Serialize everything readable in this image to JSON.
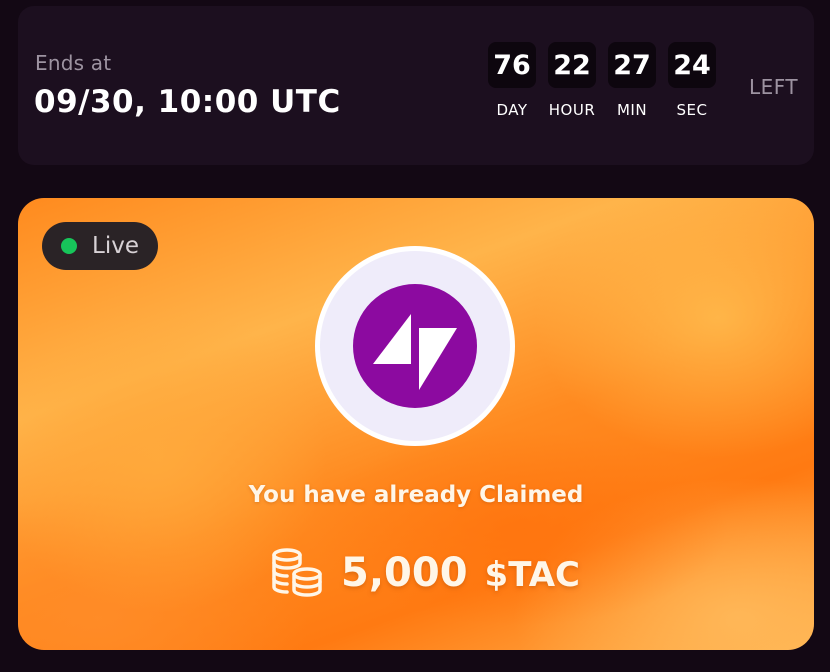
{
  "timer": {
    "ends_label": "Ends at",
    "ends_value": "09/30, 10:00 UTC",
    "units": [
      {
        "value": "76",
        "label": "DAY"
      },
      {
        "value": "22",
        "label": "HOUR"
      },
      {
        "value": "27",
        "label": "MIN"
      },
      {
        "value": "24",
        "label": "SEC"
      }
    ],
    "left_label": "LEFT"
  },
  "claim": {
    "status_label": "Live",
    "status_color": "#17c55a",
    "logo_icon": "tac-logo-icon",
    "logo_color": "#8c0aa0",
    "message": "You have already Claimed",
    "coins_icon": "coins-stack-icon",
    "amount": "5,000",
    "token": "$TAC"
  }
}
